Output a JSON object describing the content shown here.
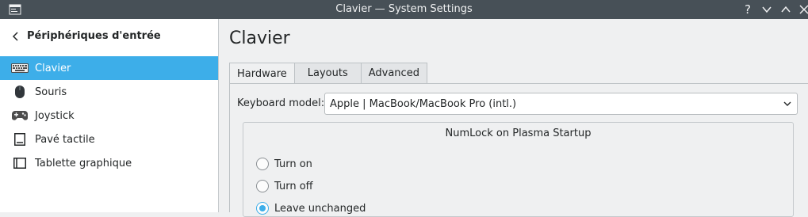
{
  "window": {
    "title": "Clavier — System Settings",
    "help_glyph": "?",
    "titlebar_color": "#475057"
  },
  "sidebar": {
    "back_label": "Périphériques d'entrée",
    "items": [
      {
        "label": "Clavier",
        "icon": "keyboard-icon",
        "selected": true
      },
      {
        "label": "Souris",
        "icon": "mouse-icon"
      },
      {
        "label": "Joystick",
        "icon": "gamepad-icon"
      },
      {
        "label": "Pavé tactile",
        "icon": "touchpad-icon"
      },
      {
        "label": "Tablette graphique",
        "icon": "tablet-icon"
      }
    ],
    "selection_color": "#3daee9"
  },
  "main": {
    "title": "Clavier",
    "tabs": [
      {
        "label": "Hardware",
        "active": true
      },
      {
        "label": "Layouts"
      },
      {
        "label": "Advanced"
      }
    ],
    "keyboard_model": {
      "label": "Keyboard model:",
      "value": "Apple | MacBook/MacBook Pro (intl.)"
    },
    "numlock": {
      "title": "NumLock on Plasma Startup",
      "options": [
        {
          "label": "Turn on",
          "checked": false
        },
        {
          "label": "Turn off",
          "checked": false
        },
        {
          "label": "Leave unchanged",
          "checked": true
        }
      ]
    }
  }
}
